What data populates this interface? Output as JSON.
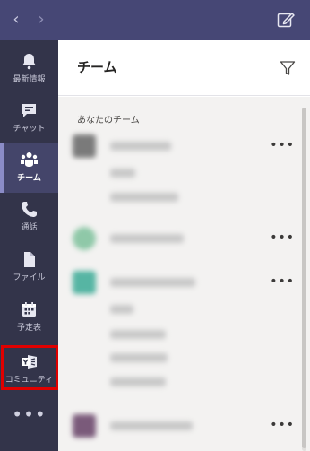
{
  "app": {
    "colors": {
      "topbar": "#464775",
      "rail": "#33344a",
      "accent": "#8b8cc7",
      "highlight": "#e00000"
    }
  },
  "rail": {
    "items": [
      {
        "label": "最新情報",
        "icon": "bell-icon"
      },
      {
        "label": "チャット",
        "icon": "chat-icon"
      },
      {
        "label": "チーム",
        "icon": "teams-icon"
      },
      {
        "label": "通話",
        "icon": "phone-icon"
      },
      {
        "label": "ファイル",
        "icon": "file-icon"
      },
      {
        "label": "予定表",
        "icon": "calendar-icon"
      },
      {
        "label": "コミュニティ",
        "icon": "yammer-icon"
      }
    ],
    "more": "•••"
  },
  "header": {
    "title": "チーム"
  },
  "list": {
    "section_label": "あなたのチーム",
    "more_label": "•••"
  }
}
